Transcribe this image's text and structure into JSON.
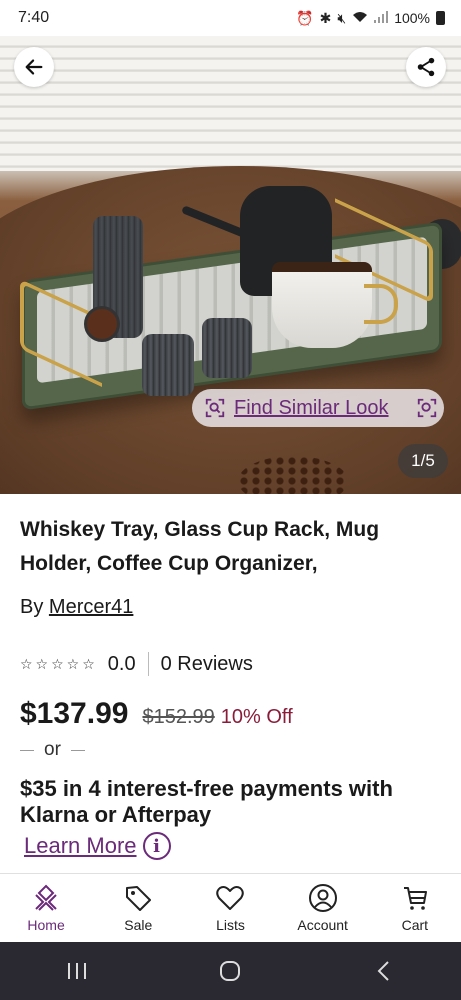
{
  "status_bar": {
    "time": "7:40",
    "battery": "100%"
  },
  "hero": {
    "find_similar_label": "Find Similar Look",
    "image_counter": "1/5"
  },
  "product": {
    "title": "Whiskey Tray, Glass Cup Rack, Mug Holder, Coffee Cup Organizer,",
    "by_prefix": "By",
    "seller": "Mercer41",
    "rating_value": "0.0",
    "reviews": "0 Reviews",
    "price": "$137.99",
    "old_price": "$152.99",
    "discount": "10% Off",
    "or_label": "or",
    "installments": "$35 in 4 interest-free payments with Klarna or Afterpay",
    "learn_more": "Learn More"
  },
  "tabs": [
    {
      "label": "Home",
      "icon": "home-icon",
      "active": true
    },
    {
      "label": "Sale",
      "icon": "tag-icon",
      "active": false
    },
    {
      "label": "Lists",
      "icon": "heart-icon",
      "active": false
    },
    {
      "label": "Account",
      "icon": "account-icon",
      "active": false
    },
    {
      "label": "Cart",
      "icon": "cart-icon",
      "active": false
    }
  ],
  "colors": {
    "accent": "#6b2a7a",
    "discount": "#8a1c3a",
    "nav_bar": "#2a2830"
  }
}
